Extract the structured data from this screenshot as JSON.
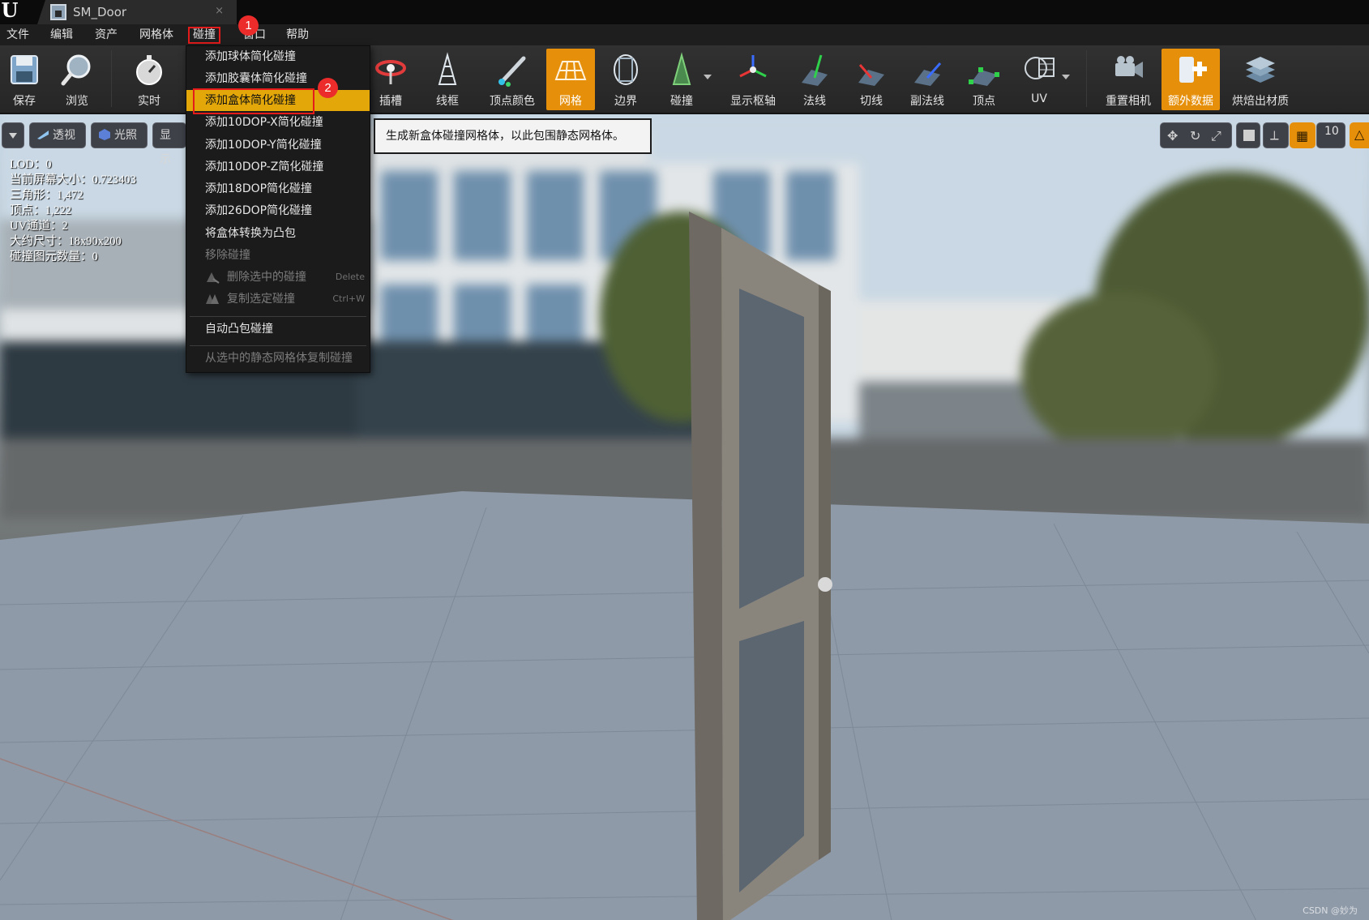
{
  "titlebar": {
    "tab_title": "SM_Door",
    "tab_close": "×"
  },
  "menubar": {
    "items": [
      "文件",
      "编辑",
      "资产",
      "网格体",
      "碰撞",
      "窗口",
      "帮助"
    ]
  },
  "toolbar": {
    "buttons": [
      {
        "label": "保存",
        "icon": "save-icon"
      },
      {
        "label": "浏览",
        "icon": "browse-magnifier-icon"
      },
      {
        "label": "实时",
        "icon": "realtime-stopwatch-icon"
      },
      {
        "label": "插槽",
        "icon": "socket-icon"
      },
      {
        "label": "线框",
        "icon": "wireframe-icon"
      },
      {
        "label": "顶点颜色",
        "icon": "vertex-color-icon"
      },
      {
        "label": "网格",
        "icon": "grid-icon",
        "active": true
      },
      {
        "label": "边界",
        "icon": "bounds-icon"
      },
      {
        "label": "碰撞",
        "icon": "collision-icon"
      },
      {
        "label": "显示枢轴",
        "icon": "pivot-icon"
      },
      {
        "label": "法线",
        "icon": "normals-icon"
      },
      {
        "label": "切线",
        "icon": "tangents-icon"
      },
      {
        "label": "副法线",
        "icon": "binormals-icon"
      },
      {
        "label": "顶点",
        "icon": "vertices-icon"
      },
      {
        "label": "UV",
        "icon": "uv-icon"
      },
      {
        "label": "重置相机",
        "icon": "reset-camera-icon"
      },
      {
        "label": "额外数据",
        "icon": "additional-data-icon",
        "active": true
      },
      {
        "label": "烘焙出材质",
        "icon": "bake-material-icon"
      }
    ],
    "active_color": "#e58f0a"
  },
  "viewport_toolbar": {
    "perspective": "透视",
    "lit": "光照",
    "show": "显示",
    "grid_snap_value": "10"
  },
  "stats": [
    "LOD：0",
    "当前屏幕大小：0.723403",
    "三角形：1,472",
    "顶点：1,222",
    "UV通道：2",
    "大约尺寸：18x90x200",
    "碰撞图元数量：0"
  ],
  "dropdown": {
    "items": [
      {
        "label": "添加球体简化碰撞"
      },
      {
        "label": "添加胶囊体简化碰撞"
      },
      {
        "label": "添加盒体简化碰撞",
        "highlighted": true
      },
      {
        "label": "添加10DOP-X简化碰撞"
      },
      {
        "label": "添加10DOP-Y简化碰撞"
      },
      {
        "label": "添加10DOP-Z简化碰撞"
      },
      {
        "label": "添加18DOP简化碰撞"
      },
      {
        "label": "添加26DOP简化碰撞"
      },
      {
        "label": "将盒体转换为凸包"
      },
      {
        "label": "移除碰撞",
        "disabled": true
      },
      {
        "label": "删除选中的碰撞",
        "disabled": true,
        "shortcut": "Delete",
        "icon": "delete-collision-icon"
      },
      {
        "label": "复制选定碰撞",
        "disabled": true,
        "shortcut": "Ctrl+W",
        "icon": "duplicate-collision-icon"
      },
      {
        "label": "自动凸包碰撞"
      },
      {
        "label": "从选中的静态网格体复制碰撞",
        "disabled": true
      }
    ],
    "highlight_color": "#e3a70a"
  },
  "tooltip": "生成新盒体碰撞网格体，以此包围静态网格体。",
  "badges": [
    "1",
    "2"
  ],
  "watermark": "CSDN @妙为"
}
